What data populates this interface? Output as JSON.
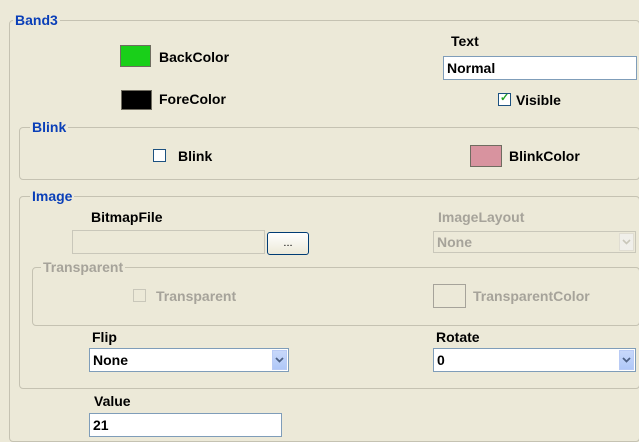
{
  "band": {
    "title": "Band3",
    "backcolor_label": "BackColor",
    "backcolor_value": "#19cf19",
    "forecolor_label": "ForeColor",
    "forecolor_value": "#000000",
    "text_label": "Text",
    "text_value": "Normal",
    "visible_label": "Visible",
    "visible_checked": true
  },
  "blink": {
    "title": "Blink",
    "blink_label": "Blink",
    "blink_checked": false,
    "blinkcolor_label": "BlinkColor",
    "blinkcolor_value": "#d8939f"
  },
  "image": {
    "title": "Image",
    "bitmapfile_label": "BitmapFile",
    "bitmapfile_value": "",
    "browse_label": "...",
    "imagelayout_label": "ImageLayout",
    "imagelayout_value": "None",
    "transparent_group": "Transparent",
    "transparent_label": "Transparent",
    "transparent_checked": false,
    "transparentcolor_label": "TransparentColor",
    "transparentcolor_value": "#ece9d8",
    "flip_label": "Flip",
    "flip_value": "None",
    "rotate_label": "Rotate",
    "rotate_value": "0"
  },
  "value": {
    "label": "Value",
    "value": "21"
  }
}
